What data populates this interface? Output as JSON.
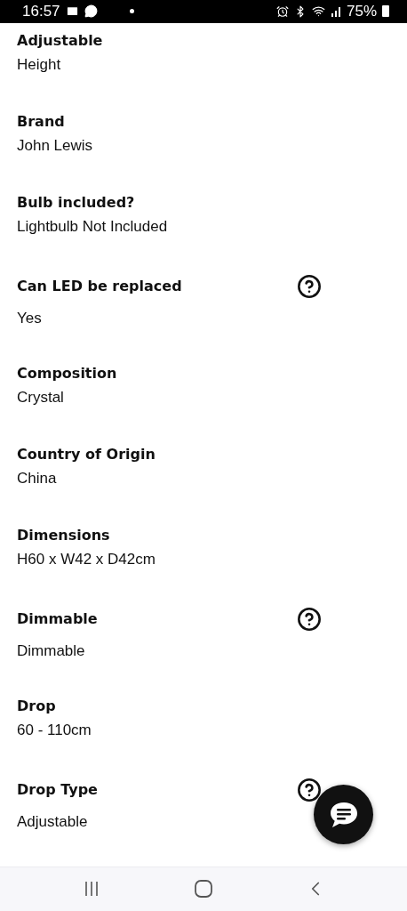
{
  "status_bar": {
    "time": "16:57",
    "battery": "75%"
  },
  "specs": [
    {
      "label": "Adjustable",
      "value": "Height",
      "has_help": false
    },
    {
      "label": "Brand",
      "value": "John Lewis",
      "has_help": false
    },
    {
      "label": "Bulb included?",
      "value": "Lightbulb Not Included",
      "has_help": false
    },
    {
      "label": "Can LED be replaced",
      "value": "Yes",
      "has_help": true
    },
    {
      "label": "Composition",
      "value": "Crystal",
      "has_help": false
    },
    {
      "label": "Country of Origin",
      "value": "China",
      "has_help": false
    },
    {
      "label": "Dimensions",
      "value": "H60 x W42 x D42cm",
      "has_help": false
    },
    {
      "label": "Dimmable",
      "value": "Dimmable",
      "has_help": true
    },
    {
      "label": "Drop",
      "value": "60 - 110cm",
      "has_help": false
    },
    {
      "label": "Drop Type",
      "value": "Adjustable",
      "has_help": true
    }
  ]
}
